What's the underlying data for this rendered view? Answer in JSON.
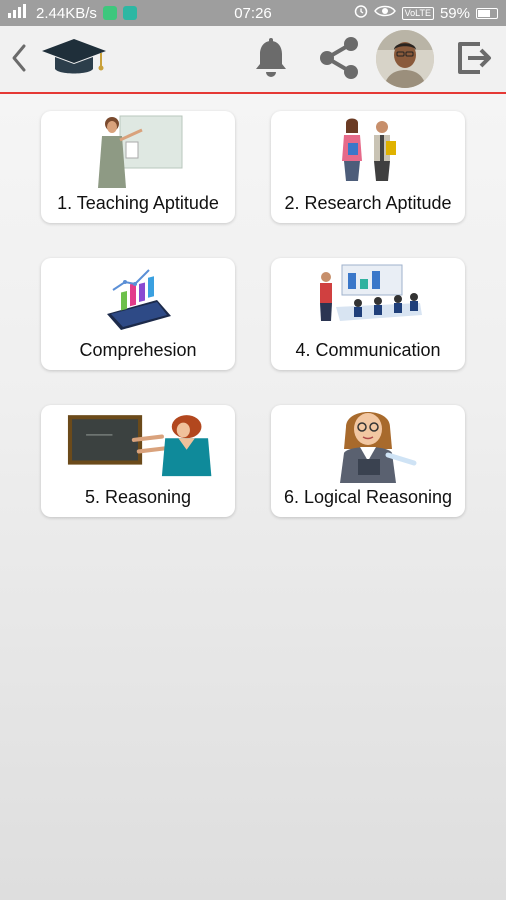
{
  "status": {
    "speed": "2.44KB/s",
    "time": "07:26",
    "volte": "VoLTE",
    "battery": "59%"
  },
  "appbar": {
    "back_icon": "chevron-left-icon",
    "logo_icon": "graduation-cap-icon",
    "bell_icon": "bell-icon",
    "share_icon": "share-icon",
    "logout_icon": "logout-icon"
  },
  "topics": [
    {
      "label": "1. Teaching Aptitude",
      "icon": "teacher-illustration"
    },
    {
      "label": "2. Research Aptitude",
      "icon": "students-illustration"
    },
    {
      "label": "Comprehesion",
      "icon": "tablet-chart-illustration"
    },
    {
      "label": "4. Communication",
      "icon": "meeting-illustration"
    },
    {
      "label": "5. Reasoning",
      "icon": "blackboard-illustration"
    },
    {
      "label": "6. Logical Reasoning",
      "icon": "woman-teacher-illustration"
    }
  ],
  "colors": {
    "accent_line": "#e53935",
    "status_bar": "#9e9e9e",
    "icon_gray": "#6b6b6b"
  }
}
